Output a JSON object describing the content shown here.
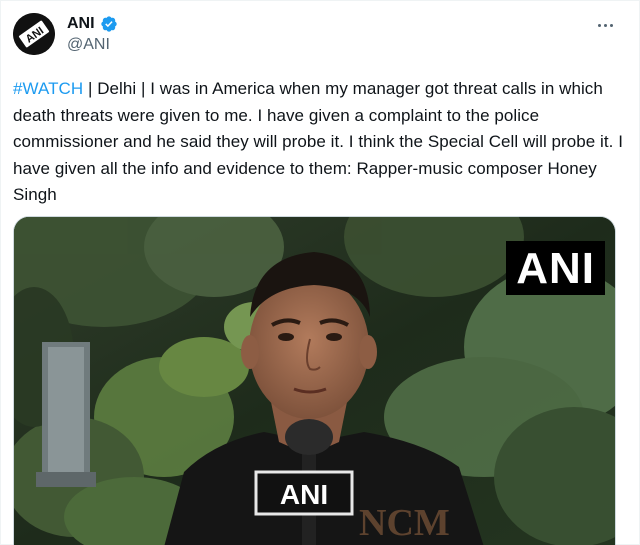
{
  "account": {
    "display_name": "ANI",
    "handle": "@ANI",
    "avatar_logo_text": "ANI",
    "verified": true
  },
  "tweet": {
    "hashtag": "#WATCH",
    "body": " | Delhi | I was in America when my manager got threat calls in which death threats were given to me. I have given a complaint to the police commissioner and he said they will probe it. I think the Special Cell will probe it. I have given all the info and evidence to them: Rapper-music composer Honey Singh"
  },
  "media": {
    "watermark": "ANI",
    "mic_logo": "ANI",
    "shirt_text": "NCM"
  },
  "icons": {
    "verified": "verified-badge-icon",
    "more": "more-options-icon"
  },
  "colors": {
    "link": "#1d9bf0",
    "text": "#0f1419",
    "secondary": "#536471"
  }
}
